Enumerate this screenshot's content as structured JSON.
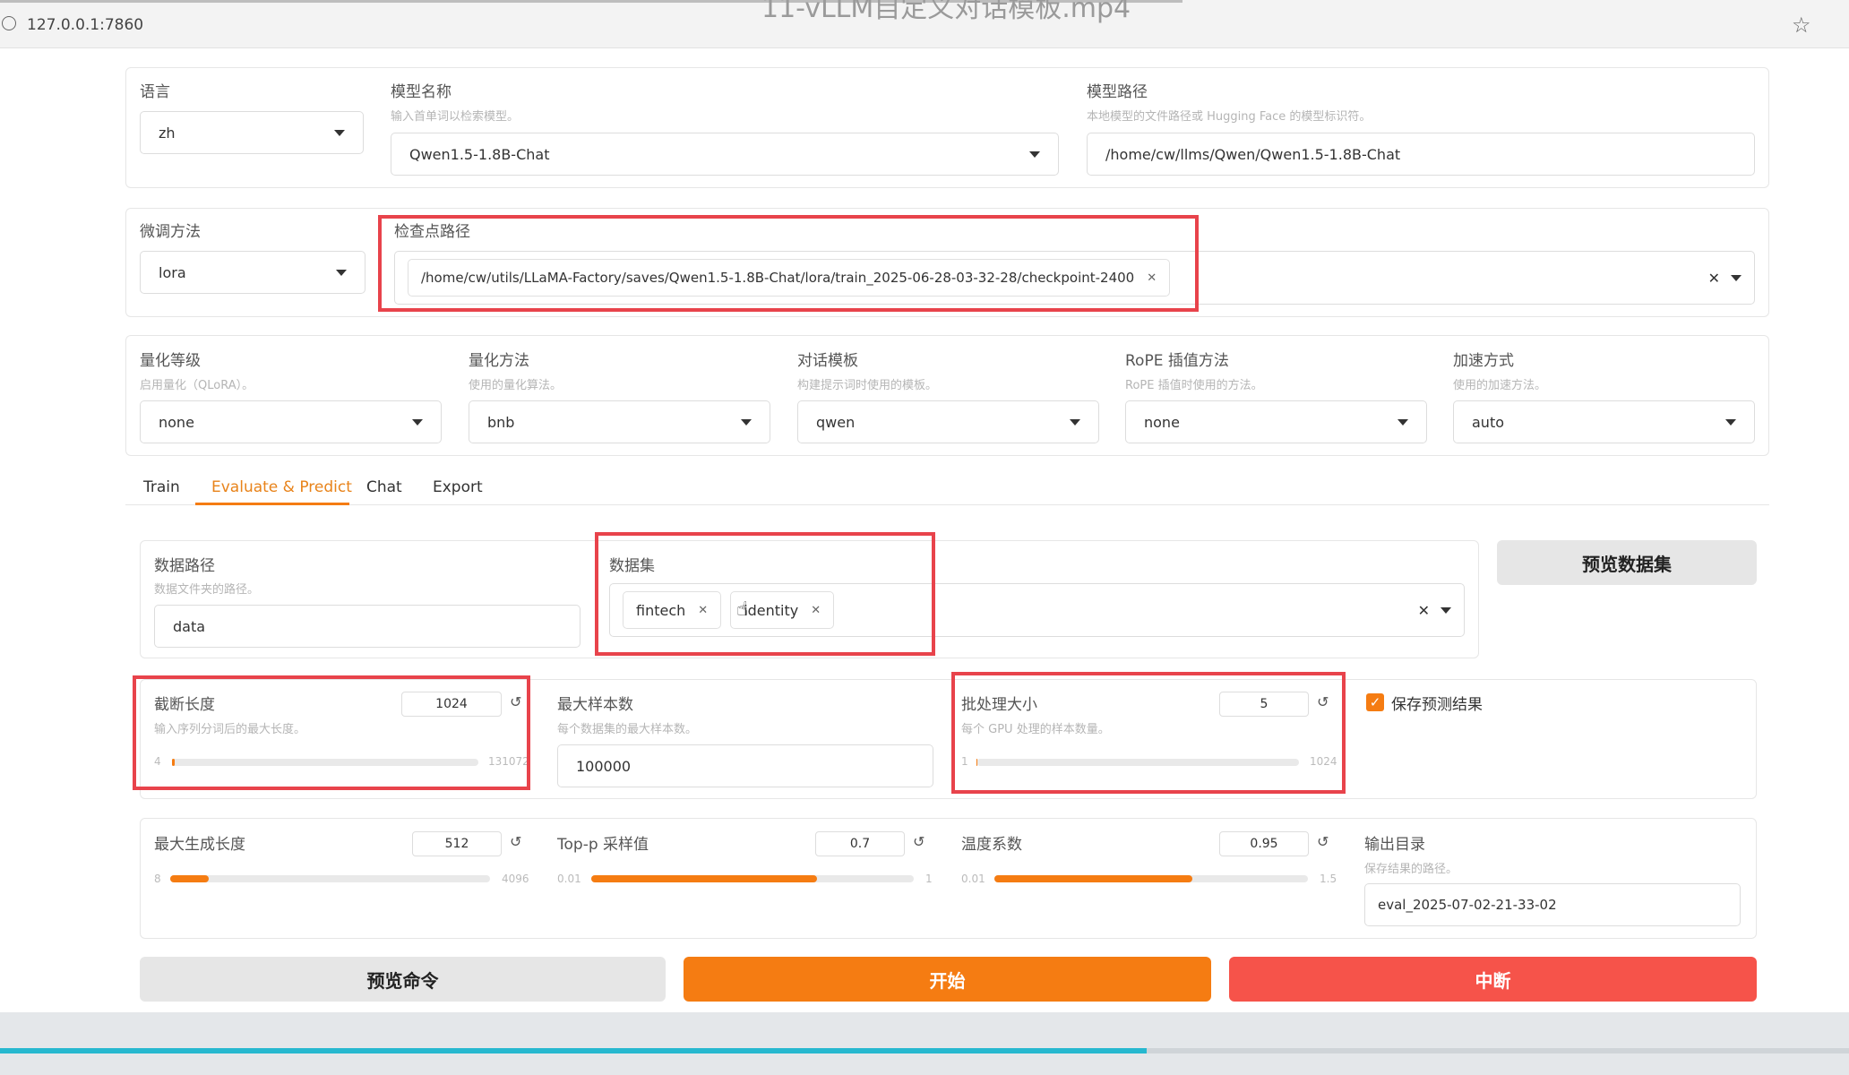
{
  "browser": {
    "url": "127.0.0.1:7860",
    "title": "11-vLLM自定义对话模板.mp4"
  },
  "top": {
    "lang_label": "语言",
    "lang_value": "zh",
    "model_name_label": "模型名称",
    "model_name_hint": "输入首单词以检索模型。",
    "model_name_value": "Qwen1.5-1.8B-Chat",
    "model_path_label": "模型路径",
    "model_path_hint": "本地模型的文件路径或 Hugging Face 的模型标识符。",
    "model_path_value": "/home/cw/llms/Qwen/Qwen1.5-1.8B-Chat"
  },
  "finetune": {
    "method_label": "微调方法",
    "method_value": "lora",
    "checkpoint_label": "检查点路径",
    "checkpoint_value": "/home/cw/utils/LLaMA-Factory/saves/Qwen1.5-1.8B-Chat/lora/train_2025-06-28-03-32-28/checkpoint-2400"
  },
  "quant": {
    "level_label": "量化等级",
    "level_hint": "启用量化（QLoRA）。",
    "level_value": "none",
    "method_label": "量化方法",
    "method_hint": "使用的量化算法。",
    "method_value": "bnb",
    "template_label": "对话模板",
    "template_hint": "构建提示词时使用的模板。",
    "template_value": "qwen",
    "rope_label": "RoPE 插值方法",
    "rope_hint": "RoPE 插值时使用的方法。",
    "rope_value": "none",
    "accel_label": "加速方式",
    "accel_hint": "使用的加速方法。",
    "accel_value": "auto"
  },
  "tabs": [
    "Train",
    "Evaluate & Predict",
    "Chat",
    "Export"
  ],
  "eval": {
    "data_path_label": "数据路径",
    "data_path_hint": "数据文件夹的路径。",
    "data_path_value": "data",
    "dataset_label": "数据集",
    "datasets": [
      "fintech",
      "identity"
    ],
    "preview_dataset_btn": "预览数据集",
    "cutoff_label": "截断长度",
    "cutoff_hint": "输入序列分词后的最大长度。",
    "cutoff_value": "1024",
    "cutoff_min": "4",
    "cutoff_max": "131072",
    "max_samples_label": "最大样本数",
    "max_samples_hint": "每个数据集的最大样本数。",
    "max_samples_value": "100000",
    "batch_label": "批处理大小",
    "batch_hint": "每个 GPU 处理的样本数量。",
    "batch_value": "5",
    "batch_min": "1",
    "batch_max": "1024",
    "save_pred_label": "保存预测结果",
    "max_new_label": "最大生成长度",
    "max_new_value": "512",
    "max_new_min": "8",
    "max_new_max": "4096",
    "top_p_label": "Top-p 采样值",
    "top_p_value": "0.7",
    "top_p_min": "0.01",
    "top_p_max": "1",
    "temp_label": "温度系数",
    "temp_value": "0.95",
    "temp_min": "0.01",
    "temp_max": "1.5",
    "output_label": "输出目录",
    "output_hint": "保存结果的路径。",
    "output_value": "eval_2025-07-02-21-33-02"
  },
  "sliders": {
    "cutoff": 0.008,
    "batch": 0.004,
    "max_new": 0.12,
    "top_p": 0.7,
    "temp": 0.63
  },
  "actions": {
    "preview_cmd": "预览命令",
    "start": "开始",
    "abort": "中断"
  },
  "colors": {
    "accent": "#f57c12",
    "danger": "#f6534a",
    "highlight": "#e8434b"
  }
}
